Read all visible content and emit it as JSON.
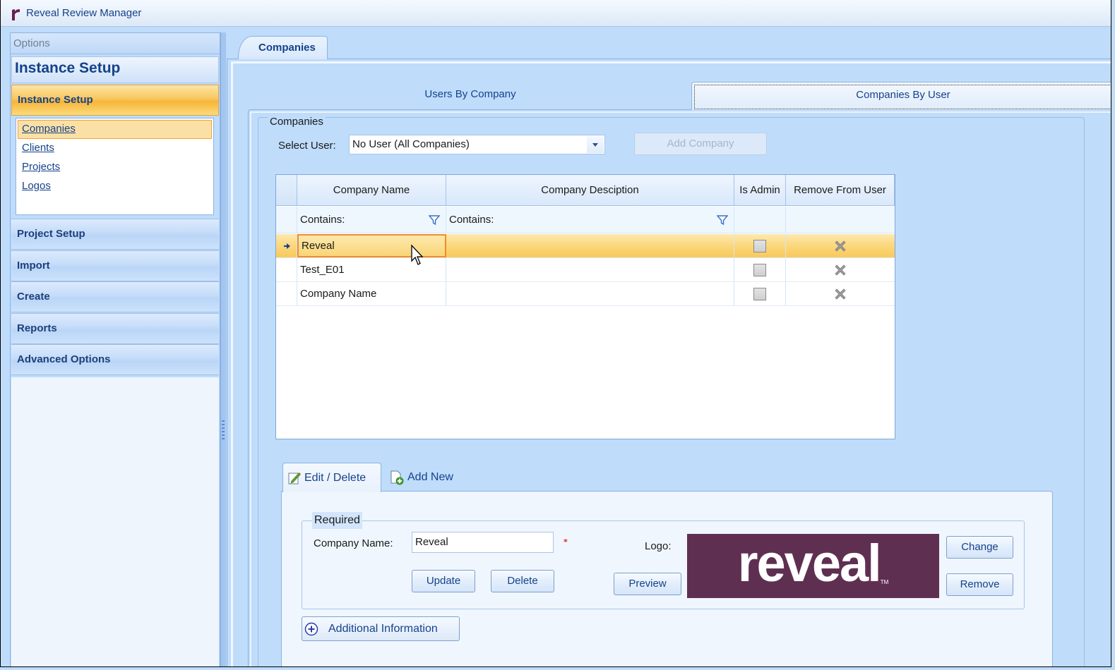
{
  "app": {
    "title": "Reveal Review Manager",
    "brand_color": "#6b1e4e"
  },
  "sidebar": {
    "options_label": "Options",
    "section_title": "Instance Setup",
    "active_group": "Instance Setup",
    "sub_items": [
      {
        "label": "Companies",
        "active": true
      },
      {
        "label": "Clients",
        "active": false
      },
      {
        "label": "Projects",
        "active": false
      },
      {
        "label": "Logos",
        "active": false
      }
    ],
    "groups": [
      {
        "label": "Project Setup"
      },
      {
        "label": "Import"
      },
      {
        "label": "Create"
      },
      {
        "label": "Reports"
      },
      {
        "label": "Advanced Options"
      }
    ]
  },
  "main_tab": {
    "label": "Companies"
  },
  "sub_tabs": [
    {
      "label": "Users By Company",
      "active": false
    },
    {
      "label": "Companies By User",
      "active": true
    }
  ],
  "companies_group": {
    "legend": "Companies",
    "select_user_label": "Select User:",
    "select_user_value": "No User (All Companies)",
    "add_company_label": "Add Company",
    "add_company_enabled": false
  },
  "grid": {
    "columns": [
      "Company Name",
      "Company Desciption",
      "Is Admin",
      "Remove From User"
    ],
    "filter_labels": [
      "Contains:",
      "Contains:"
    ],
    "rows": [
      {
        "name": "Reveal",
        "description": "",
        "is_admin": false,
        "selected": true
      },
      {
        "name": "Test_E01",
        "description": "",
        "is_admin": false,
        "selected": false
      },
      {
        "name": "Company Name",
        "description": "",
        "is_admin": false,
        "selected": false
      }
    ]
  },
  "detail_tabs": [
    {
      "label": "Edit / Delete",
      "icon": "edit-icon",
      "active": true
    },
    {
      "label": "Add New",
      "icon": "add-document-icon",
      "active": false
    }
  ],
  "required_group": {
    "legend": "Required",
    "company_name_label": "Company Name:",
    "company_name_value": "Reveal",
    "required_marker": "*",
    "update_label": "Update",
    "delete_label": "Delete",
    "logo_label": "Logo:",
    "preview_label": "Preview",
    "change_label": "Change",
    "remove_label": "Remove",
    "logo_text": "reveal",
    "logo_tm": "TM",
    "logo_bg": "#5f2f52"
  },
  "additional_info": {
    "label": "Additional Information"
  }
}
